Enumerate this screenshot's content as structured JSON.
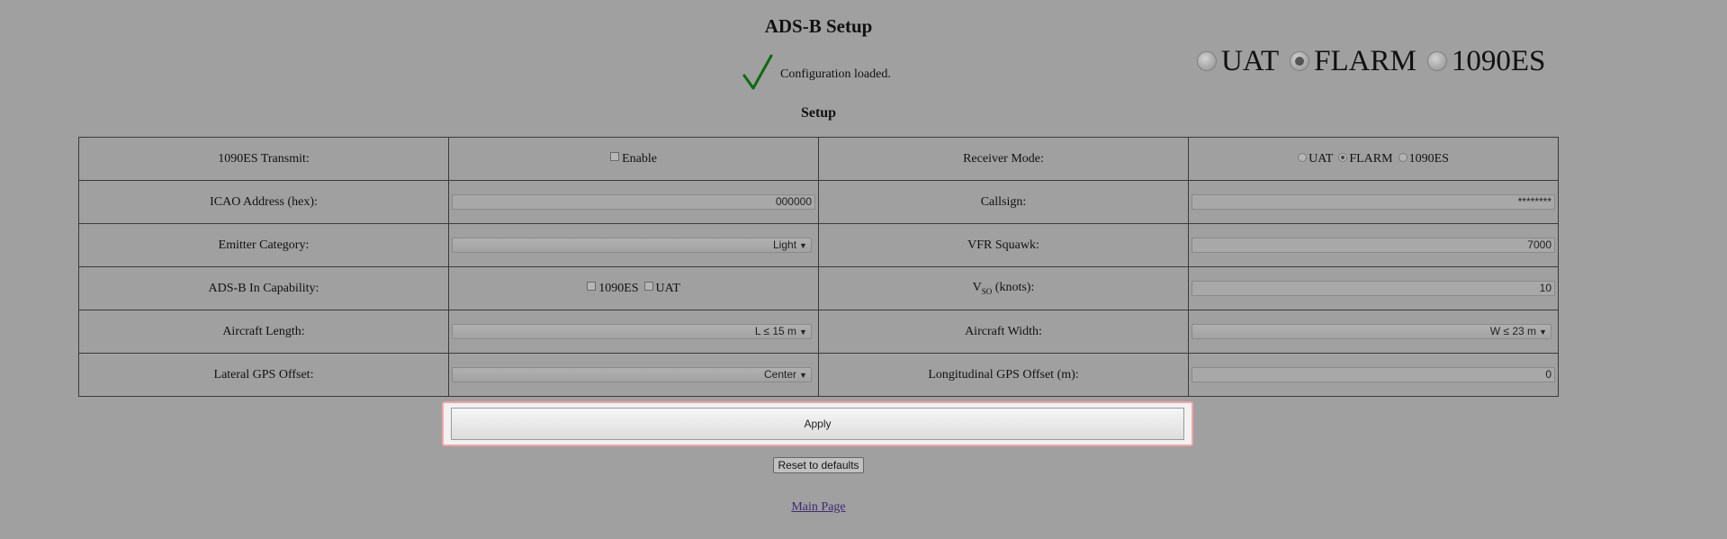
{
  "page": {
    "title": "ADS-B Setup",
    "status_message": "Configuration loaded.",
    "section_title": "Setup",
    "accent_colors": {
      "check": "#0e6b0e",
      "focus_outline": "#f4a3a8",
      "link": "#3c2b73"
    }
  },
  "big_mode_selector": {
    "options": [
      {
        "label": "UAT",
        "checked": false
      },
      {
        "label": "FLARM",
        "checked": true
      },
      {
        "label": "1090ES",
        "checked": false
      }
    ]
  },
  "form": {
    "transmit": {
      "label": "1090ES Transmit:",
      "checkbox_label": "Enable",
      "checked": false
    },
    "receiver_mode": {
      "label": "Receiver Mode:",
      "options": [
        {
          "label": "UAT",
          "checked": false
        },
        {
          "label": "FLARM",
          "checked": true
        },
        {
          "label": "1090ES",
          "checked": false
        }
      ]
    },
    "icao": {
      "label": "ICAO Address (hex):",
      "value": "000000"
    },
    "callsign": {
      "label": "Callsign:",
      "value": "********"
    },
    "emitter": {
      "label": "Emitter Category:",
      "value": "Light"
    },
    "squawk": {
      "label": "VFR Squawk:",
      "value": "7000"
    },
    "adsb_in": {
      "label": "ADS-B In Capability:",
      "options": [
        "1090ES",
        "UAT"
      ]
    },
    "vso": {
      "label_main": "V",
      "label_sub": "SO",
      "label_rest": " (knots):",
      "value": "10"
    },
    "length": {
      "label": "Aircraft Length:",
      "value": "L ≤ 15 m"
    },
    "width": {
      "label": "Aircraft Width:",
      "value": "W ≤ 23 m"
    },
    "lateral": {
      "label": "Lateral GPS Offset:",
      "value": "Center"
    },
    "longitudinal": {
      "label": "Longitudinal GPS Offset (m):",
      "value": "0"
    }
  },
  "buttons": {
    "apply": "Apply",
    "reset": "Reset to defaults"
  },
  "links": {
    "main_page": "Main Page"
  }
}
